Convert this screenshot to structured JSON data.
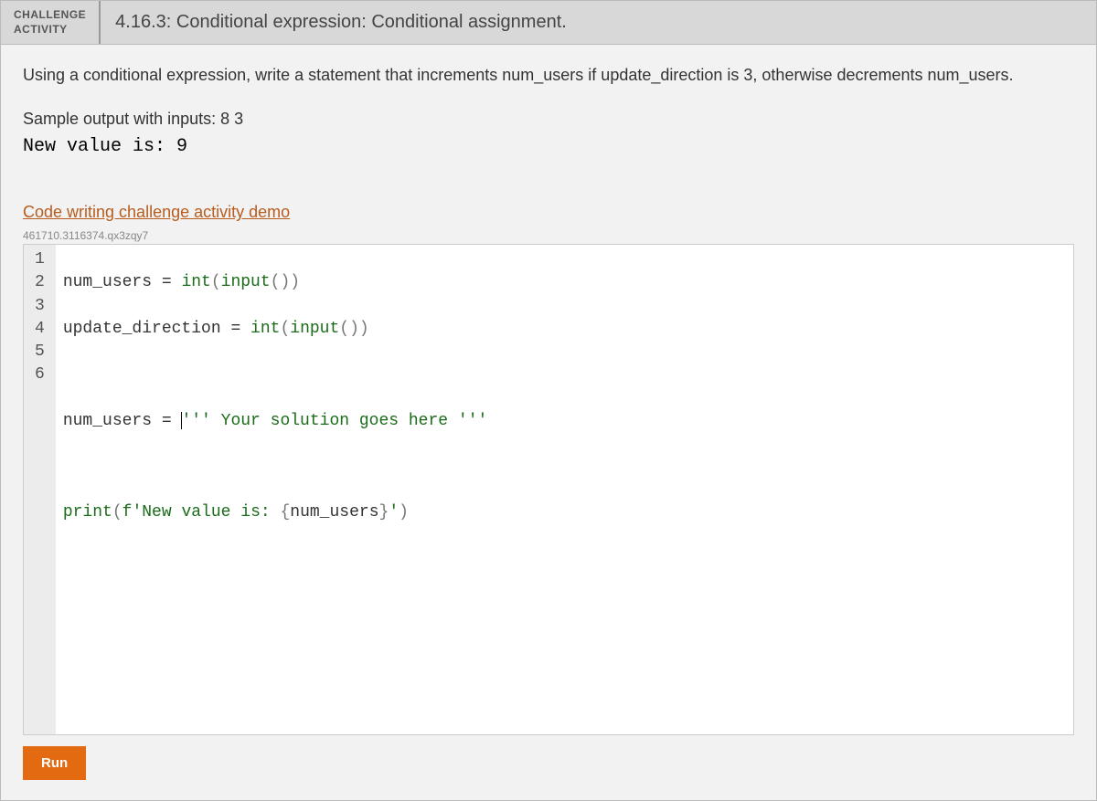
{
  "header": {
    "badge_line1": "CHALLENGE",
    "badge_line2": "ACTIVITY",
    "title": "4.16.3: Conditional expression: Conditional assignment."
  },
  "instructions": "Using a conditional expression, write a statement that increments num_users if update_direction is 3, otherwise decrements num_users.",
  "sample_label": "Sample output with inputs: 8 3",
  "sample_output": "New value is: 9",
  "demo_link": "Code writing challenge activity demo",
  "tracking_id": "461710.3116374.qx3zqy7",
  "code": {
    "gutter": [
      "1",
      "2",
      "3",
      "4",
      "5",
      "6"
    ],
    "line1": {
      "a": "num_users = ",
      "b": "int",
      "c": "(",
      "d": "input",
      "e": "()",
      "f": ")"
    },
    "line2": {
      "a": "update_direction = ",
      "b": "int",
      "c": "(",
      "d": "input",
      "e": "()",
      "f": ")"
    },
    "line3": "",
    "line4": {
      "a": "num_users = ",
      "b": "''' Your solution goes here '''"
    },
    "line5": "",
    "line6": {
      "a": "print",
      "b": "(",
      "c": "f'New value is: ",
      "d": "{",
      "e": "num_users",
      "f": "}",
      "g": "'",
      "h": ")"
    }
  },
  "run_label": "Run"
}
